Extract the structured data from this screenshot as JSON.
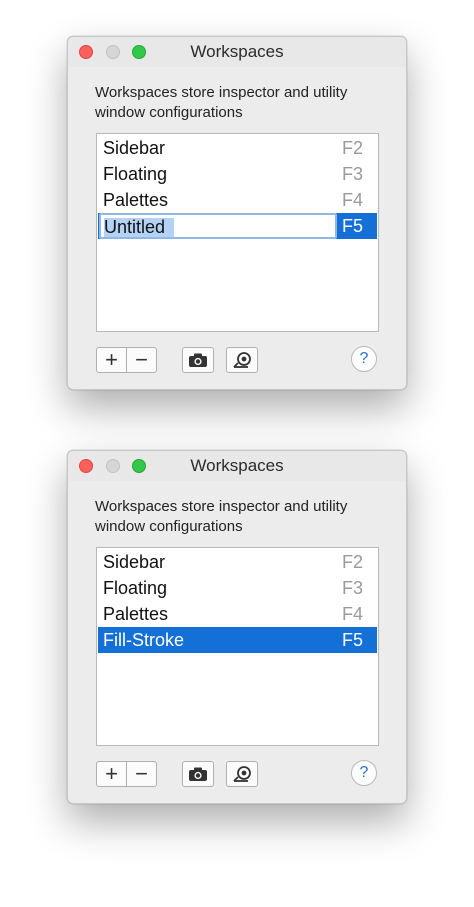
{
  "windows": [
    {
      "title": "Workspaces",
      "description": "Workspaces store inspector and utility window configurations",
      "items": [
        {
          "name": "Sidebar",
          "key": "F2"
        },
        {
          "name": "Floating",
          "key": "F3"
        },
        {
          "name": "Palettes",
          "key": "F4"
        },
        {
          "name": "Untitled",
          "key": "F5"
        }
      ],
      "editing_value": "Untitled",
      "toolbar": {
        "add": "+",
        "remove": "−",
        "help": "?"
      }
    },
    {
      "title": "Workspaces",
      "description": "Workspaces store inspector and utility window configurations",
      "items": [
        {
          "name": "Sidebar",
          "key": "F2"
        },
        {
          "name": "Floating",
          "key": "F3"
        },
        {
          "name": "Palettes",
          "key": "F4"
        },
        {
          "name": "Fill-Stroke",
          "key": "F5"
        }
      ],
      "toolbar": {
        "add": "+",
        "remove": "−",
        "help": "?"
      }
    }
  ],
  "colors": {
    "selection": "#1470d6",
    "close": "#fc605c",
    "zoom": "#34c84a"
  },
  "icons": [
    "camera-icon",
    "restore-workspace-icon",
    "help-icon"
  ]
}
